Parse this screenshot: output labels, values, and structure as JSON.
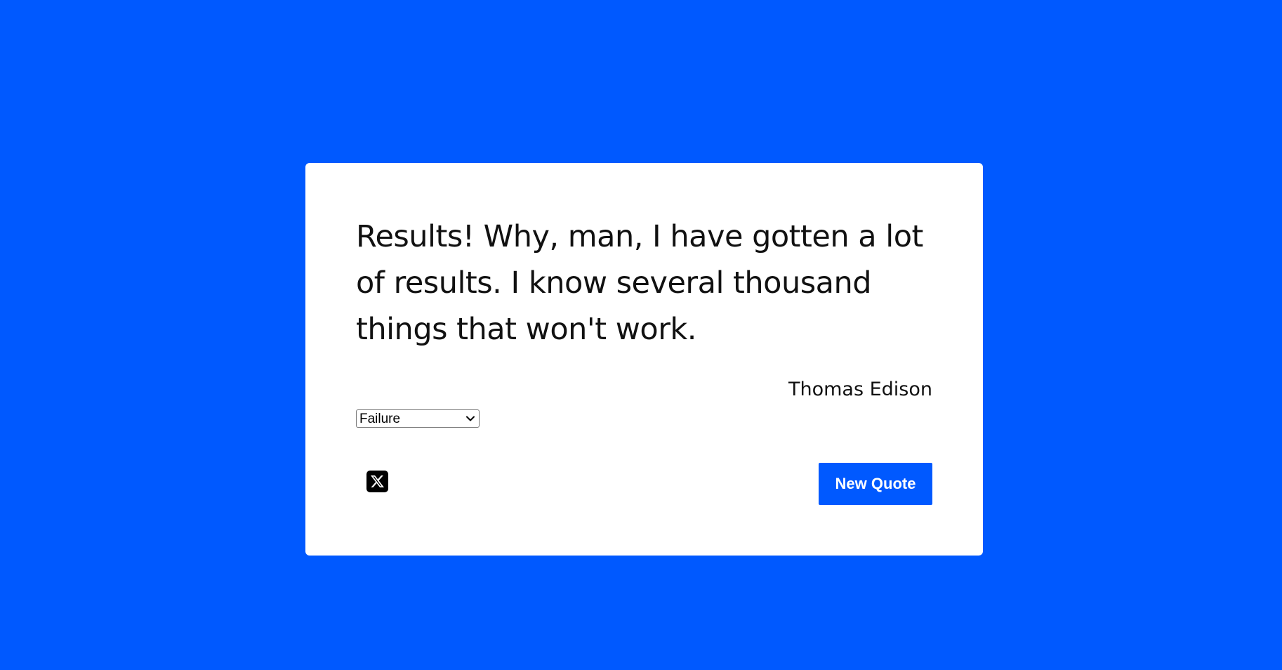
{
  "colors": {
    "background": "#0059ff",
    "card": "#ffffff",
    "accent": "#0059ff",
    "text": "#111111"
  },
  "quote": {
    "text": "Results! Why, man, I have gotten a lot of results. I know several thousand things that won't work.",
    "author": "Thomas Edison"
  },
  "category": {
    "selected": "Failure",
    "options": [
      "Failure"
    ]
  },
  "actions": {
    "tweet_icon": "x-logo-icon",
    "new_quote_label": "New Quote"
  }
}
